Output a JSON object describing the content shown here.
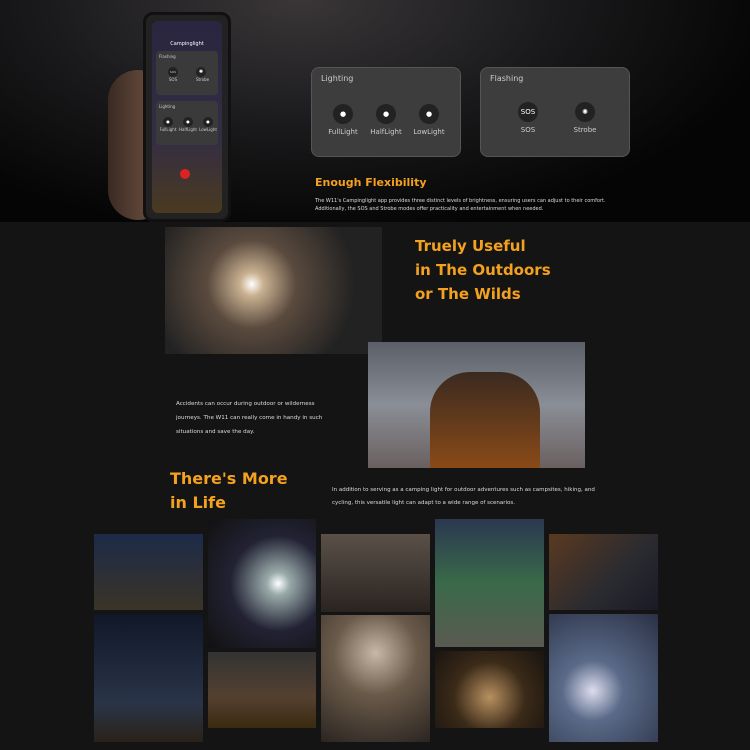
{
  "phone": {
    "title": "Campinglight",
    "flashing": "Flashing",
    "sos_icon": "SOS",
    "sos": "SOS",
    "strobe": "Strobe",
    "lighting": "Lighting",
    "full": "FullLight",
    "half": "HalfLight",
    "low": "LowLight"
  },
  "lighting_card": {
    "title": "Lighting",
    "options": [
      {
        "label": "FullLight",
        "icon": "bulb-icon"
      },
      {
        "label": "HalfLight",
        "icon": "bulb-icon"
      },
      {
        "label": "LowLight",
        "icon": "bulb-icon"
      }
    ]
  },
  "flashing_card": {
    "title": "Flashing",
    "options": [
      {
        "label": "SOS",
        "icon_text": "SOS"
      },
      {
        "label": "Strobe",
        "icon": "strobe-icon"
      }
    ]
  },
  "flex": {
    "heading": "Enough Flexibility",
    "body": "The W11's Campinglight app provides three distinct levels of brightness, ensuring users can adjust to their comfort. Additionally, the SOS and Strobe modes offer practicality and entertainment when needed."
  },
  "useful": {
    "line1": "Truely Useful",
    "line2": "in The Outdoors",
    "line3": "or The Wilds",
    "body": "Accidents can occur during outdoor or wilderness journeys. The W11 can really come in handy in such situations and save the day."
  },
  "more": {
    "line1": "There's More",
    "line2": "in Life",
    "body": "In addition to serving as a camping light for outdoor adventures such as campsites, hiking, and cycling, this versatile light can adapt to a wide range of scenarios."
  },
  "colors": {
    "accent": "#f4a11f",
    "background": "#141414",
    "card": "#3d3d3e"
  }
}
